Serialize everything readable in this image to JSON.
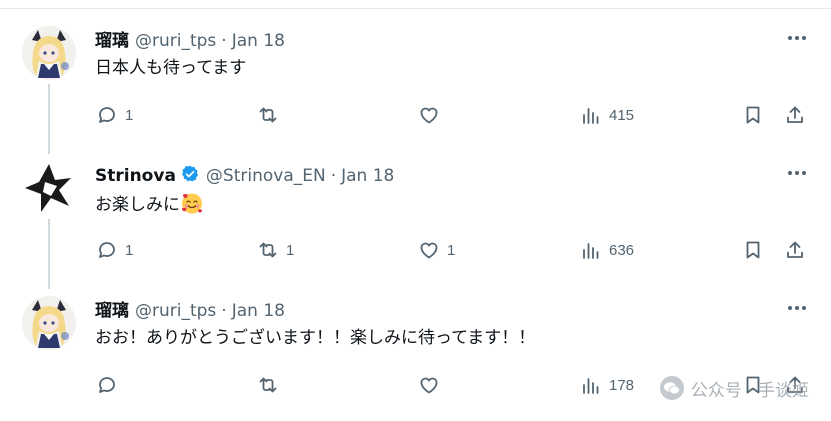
{
  "tweets": [
    {
      "name": "瑠璃",
      "handle": "@ruri_tps",
      "separator": "·",
      "date": "Jan 18",
      "text": "日本人も待ってます",
      "replies": "1",
      "retweets": "",
      "likes": "",
      "views": "415",
      "verified": false
    },
    {
      "name": "Strinova",
      "handle": "@Strinova_EN",
      "separator": "·",
      "date": "Jan 18",
      "text": "お楽しみに",
      "emoji": "smiling-face-with-hearts",
      "replies": "1",
      "retweets": "1",
      "likes": "1",
      "views": "636",
      "verified": true
    },
    {
      "name": "瑠璃",
      "handle": "@ruri_tps",
      "separator": "·",
      "date": "Jan 18",
      "text": "おお！ありがとうございます！！楽しみに待ってます！！",
      "replies": "",
      "retweets": "",
      "likes": "",
      "views": "178",
      "verified": false
    }
  ],
  "watermark": {
    "text": "公众号 · 手谈姬"
  },
  "colors": {
    "text": "#0f1419",
    "secondary": "#536471",
    "verified": "#1d9bf0",
    "thread_line": "#cfd9de"
  },
  "icons": [
    "reply-icon",
    "retweet-icon",
    "like-icon",
    "views-icon",
    "bookmark-icon",
    "share-icon",
    "more-icon",
    "verified-badge-icon"
  ]
}
